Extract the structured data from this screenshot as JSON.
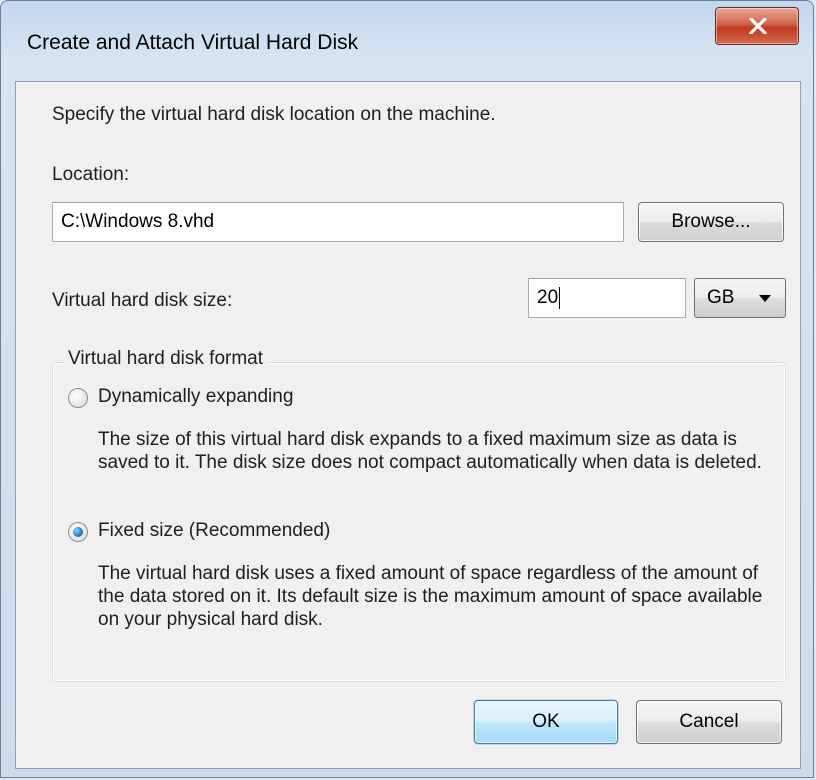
{
  "window": {
    "title": "Create and Attach Virtual Hard Disk"
  },
  "intro": "Specify the virtual hard disk location on the machine.",
  "location": {
    "label": "Location:",
    "value": "C:\\Windows 8.vhd",
    "browse_label": "Browse..."
  },
  "size": {
    "label": "Virtual hard disk size:",
    "value": "20",
    "unit_selected": "GB"
  },
  "format": {
    "group_title": "Virtual hard disk format",
    "options": [
      {
        "label": "Dynamically expanding",
        "selected": false,
        "description": "The size of this virtual hard disk expands to a fixed maximum size as data is saved to it.  The disk size does not compact automatically when data is deleted."
      },
      {
        "label": "Fixed size (Recommended)",
        "selected": true,
        "description": "The virtual hard disk uses a fixed amount of space regardless of the amount of the data stored on it.  Its default size is the maximum amount of space available on your physical hard disk."
      }
    ]
  },
  "buttons": {
    "ok_label": "OK",
    "cancel_label": "Cancel"
  },
  "icons": {
    "close": "close-icon",
    "dropdown": "chevron-down-icon"
  },
  "colors": {
    "close_button": "#c7432a",
    "radio_selected": "#2a7fc8"
  }
}
